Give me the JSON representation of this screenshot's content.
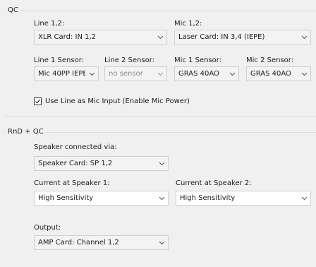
{
  "qc": {
    "title": "QC",
    "line12": {
      "label": "Line 1,2:",
      "value": "XLR Card: IN 1,2"
    },
    "mic12": {
      "label": "Mic 1,2:",
      "value": "Laser Card: IN 3,4 (IEPE)"
    },
    "line1_sensor": {
      "label": "Line 1 Sensor:",
      "value": "Mic 40PP IEPE"
    },
    "line2_sensor": {
      "label": "Line 2 Sensor:",
      "value": "no sensor"
    },
    "mic1_sensor": {
      "label": "Mic 1 Sensor:",
      "value": "GRAS 40AO"
    },
    "mic2_sensor": {
      "label": "Mic 2 Sensor:",
      "value": "GRAS 40AO"
    },
    "use_line_as_mic": {
      "label": "Use Line as Mic Input (Enable Mic Power)",
      "checked": true
    }
  },
  "rnd_qc": {
    "title": "RnD + QC",
    "speaker_via": {
      "label": "Speaker connected via:",
      "value": "Speaker Card: SP 1,2"
    },
    "current_speaker1": {
      "label": "Current at Speaker 1:",
      "value": "High Sensitivity"
    },
    "current_speaker2": {
      "label": "Current at Speaker 2:",
      "value": "High Sensitivity"
    },
    "output": {
      "label": "Output:",
      "value": "AMP Card: Channel 1,2"
    }
  },
  "icons": {
    "dropdown": "chevron-down-icon",
    "check": "checkmark-icon"
  },
  "colors": {
    "background": "#f0f0f0",
    "combo_bg": "#f3f3f3",
    "combo_border": "#d0d0d0",
    "disabled_text": "#8a8a8a"
  }
}
